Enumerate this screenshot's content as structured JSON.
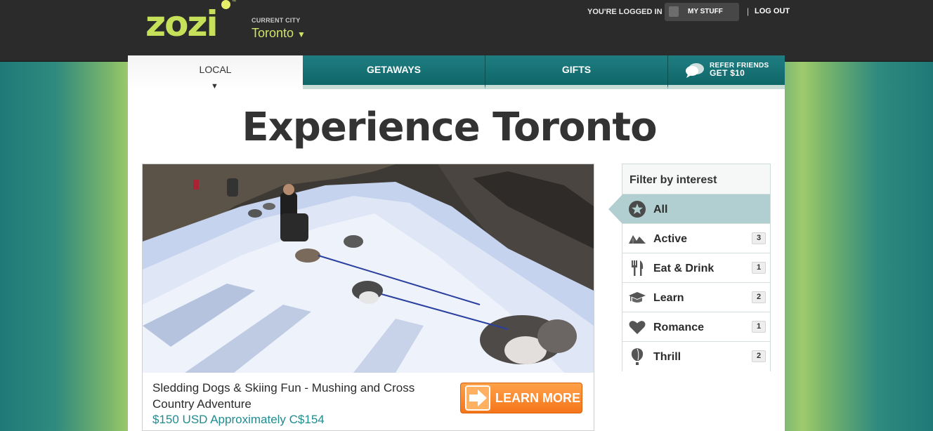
{
  "header": {
    "logo": "zozi",
    "logo_tm": "™",
    "current_city_label": "CURRENT CITY",
    "current_city": "Toronto",
    "logged_in_text": "YOU'RE LOGGED IN",
    "my_stuff_label": "MY STUFF",
    "separator": "|",
    "logout_label": "LOG OUT"
  },
  "tabs": [
    {
      "label": "LOCAL",
      "active": true
    },
    {
      "label": "GETAWAYS"
    },
    {
      "label": "GIFTS"
    },
    {
      "label_line1": "REFER FRIENDS",
      "label_line2": "GET $10",
      "icon": "speech-bubbles-icon"
    }
  ],
  "page_title": "Experience Toronto",
  "deal": {
    "image_subject": "sled-dogs-snow-trail",
    "title": "Sledding Dogs & Skiing Fun - Mushing and Cross Country Adventure",
    "price": "$150 USD Approximately C$154",
    "button_label": "LEARN MORE"
  },
  "filter": {
    "heading": "Filter by interest",
    "items": [
      {
        "label": "All",
        "icon": "star-icon",
        "count": "",
        "active": true
      },
      {
        "label": "Active",
        "icon": "mountains-icon",
        "count": "3"
      },
      {
        "label": "Eat & Drink",
        "icon": "fork-knife-icon",
        "count": "1"
      },
      {
        "label": "Learn",
        "icon": "graduation-cap-icon",
        "count": "2"
      },
      {
        "label": "Romance",
        "icon": "heart-icon",
        "count": "1"
      },
      {
        "label": "Thrill",
        "icon": "hot-air-balloon-icon",
        "count": "2"
      }
    ]
  },
  "colors": {
    "header_bg": "#2b2b2b",
    "brand_green": "#c6e05a",
    "tab_teal": "#137072",
    "filter_active": "#b1cfd0",
    "button_orange": "#f5751a",
    "price_teal": "#1f8c8f"
  }
}
